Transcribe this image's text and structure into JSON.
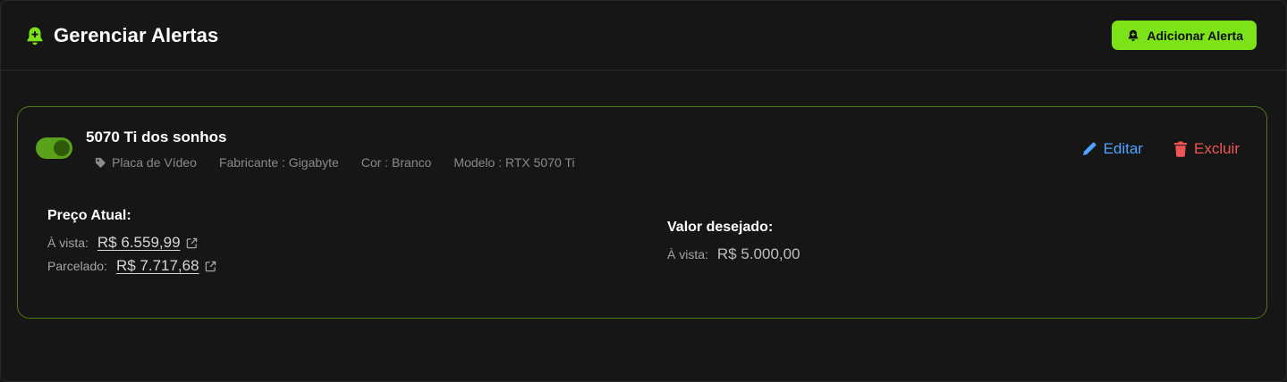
{
  "header": {
    "title": "Gerenciar Alertas",
    "add_button_label": "Adicionar Alerta",
    "accent_color": "#7ce319"
  },
  "alert": {
    "enabled": true,
    "name": "5070 Ti dos sonhos",
    "tags": {
      "category": "Placa de Vídeo",
      "manufacturer": "Fabricante : Gigabyte",
      "color": "Cor : Branco",
      "model": "Modelo : RTX 5070 Ti"
    },
    "actions": {
      "edit_label": "Editar",
      "delete_label": "Excluir"
    },
    "current_price": {
      "title": "Preço Atual:",
      "cash_label": "À vista:",
      "cash_value": "R$ 6.559,99",
      "installment_label": "Parcelado:",
      "installment_value": "R$ 7.717,68"
    },
    "desired_price": {
      "title": "Valor desejado:",
      "cash_label": "À vista:",
      "cash_value": "R$ 5.000,00"
    }
  },
  "icons": {
    "title": "bell-plus-icon",
    "add_button": "bell-plus-icon",
    "category_tag": "tag-icon",
    "edit": "pencil-icon",
    "delete": "trash-icon",
    "external_link": "external-link-icon"
  },
  "colors": {
    "edit": "#4da3ff",
    "delete": "#f05454",
    "card_border": "#4d7a12"
  }
}
